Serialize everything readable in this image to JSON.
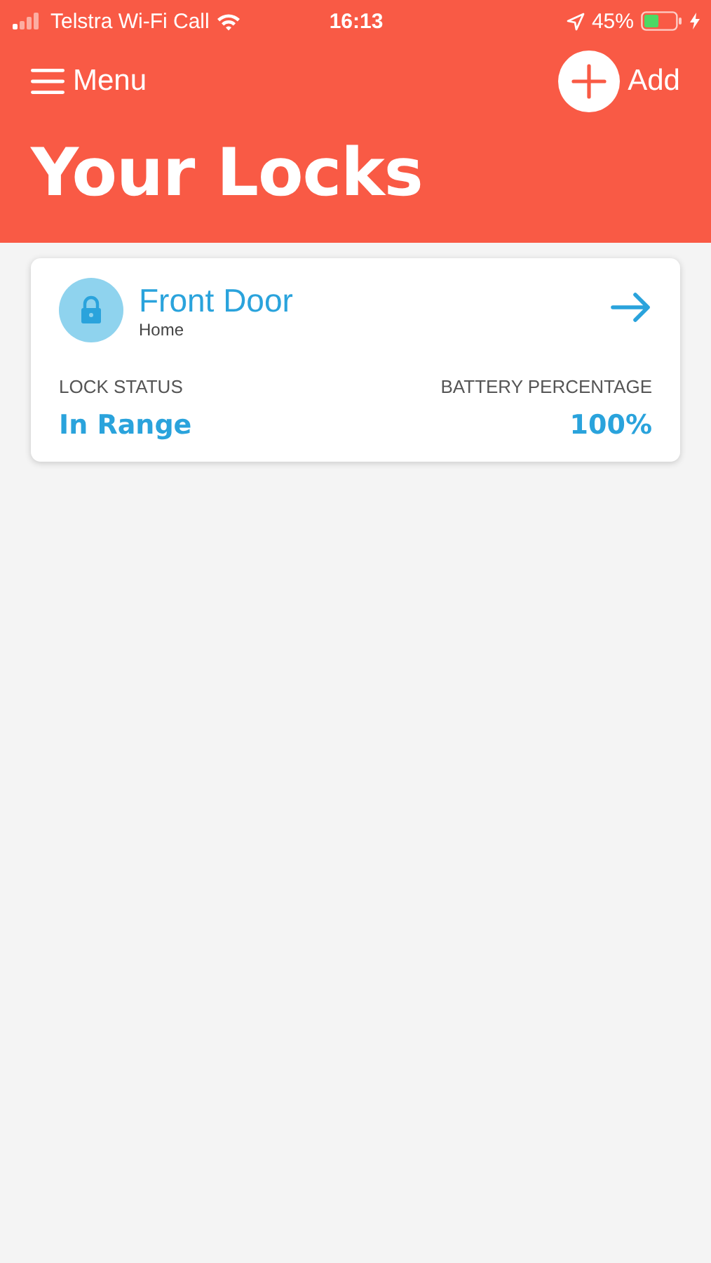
{
  "status_bar": {
    "carrier": "Telstra Wi-Fi Call",
    "time": "16:13",
    "battery": "45%"
  },
  "nav": {
    "menu": "Menu",
    "add": "Add"
  },
  "title": "Your Locks",
  "locks": [
    {
      "name": "Front Door",
      "place": "Home",
      "status_label": "LOCK STATUS",
      "status": "In Range",
      "battery_label": "BATTERY PERCENTAGE",
      "battery": "100%"
    }
  ]
}
